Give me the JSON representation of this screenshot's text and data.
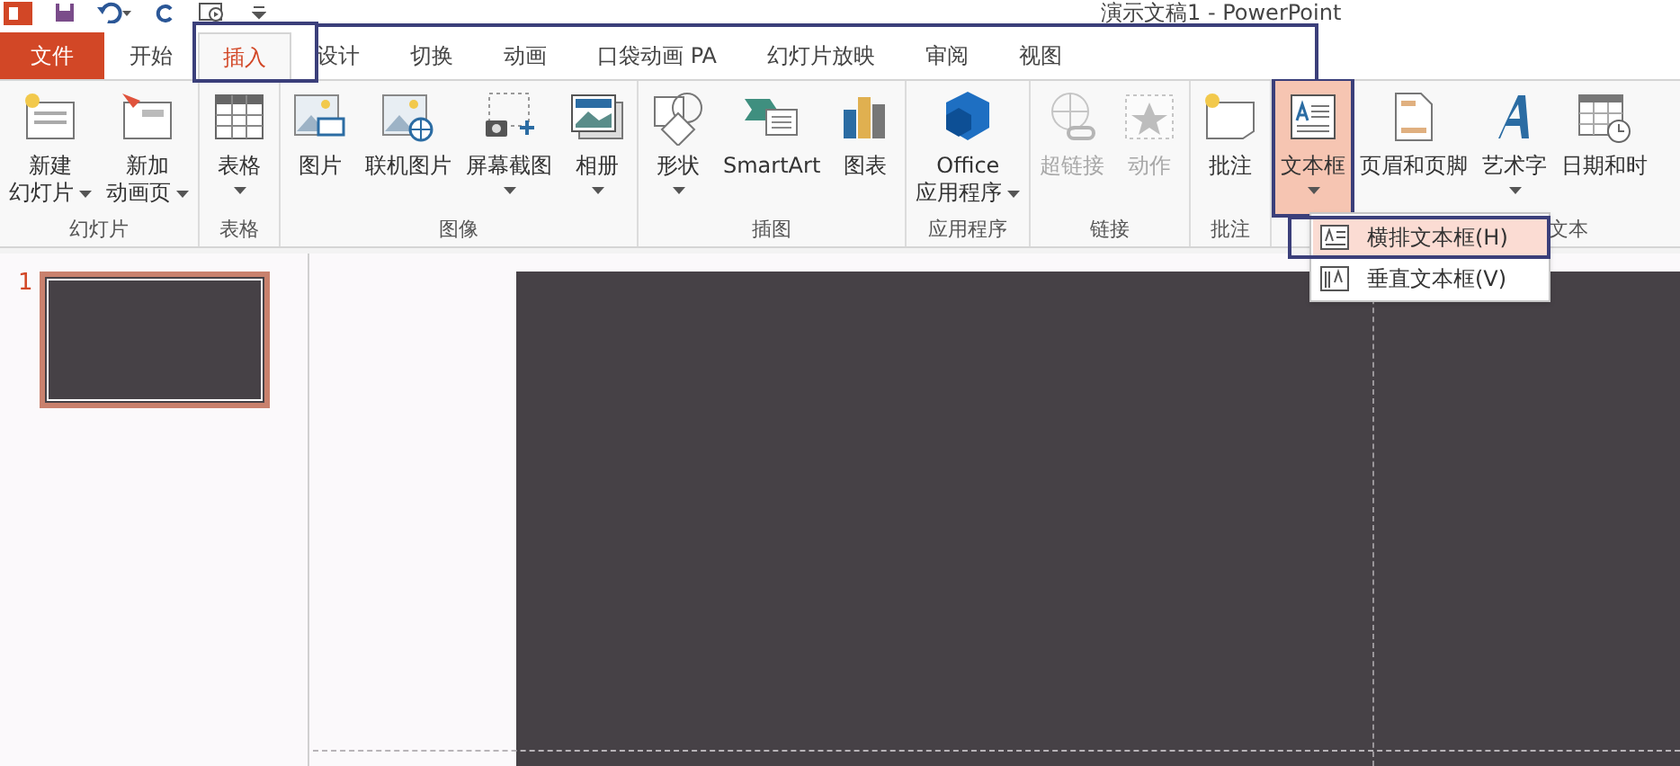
{
  "title_bar": {
    "title": "演示文稿1 - PowerPoint"
  },
  "tabs": [
    {
      "label": "文件",
      "kind": "file",
      "selected": false
    },
    {
      "label": "开始",
      "kind": "tab",
      "selected": false
    },
    {
      "label": "插入",
      "kind": "tab",
      "selected": true
    },
    {
      "label": "设计",
      "kind": "tab",
      "selected": false
    },
    {
      "label": "切换",
      "kind": "tab",
      "selected": false
    },
    {
      "label": "动画",
      "kind": "tab",
      "selected": false
    },
    {
      "label": "口袋动画 PA",
      "kind": "tab",
      "selected": false
    },
    {
      "label": "幻灯片放映",
      "kind": "tab",
      "selected": false
    },
    {
      "label": "审阅",
      "kind": "tab",
      "selected": false
    },
    {
      "label": "视图",
      "kind": "tab",
      "selected": false
    }
  ],
  "ribbon": {
    "groups": [
      {
        "label": "幻灯片",
        "buttons": [
          {
            "kind": "slide",
            "lines": [
              "新建",
              "幻灯片"
            ],
            "dropdown": true,
            "disabled": false,
            "pressed": false
          },
          {
            "kind": "animpage",
            "lines": [
              "新加",
              "动画页"
            ],
            "dropdown": true,
            "disabled": false,
            "pressed": false
          }
        ]
      },
      {
        "label": "表格",
        "buttons": [
          {
            "kind": "table",
            "lines": [
              "表格"
            ],
            "dropdown": true,
            "disabled": false,
            "pressed": false
          }
        ]
      },
      {
        "label": "图像",
        "buttons": [
          {
            "kind": "picture",
            "lines": [
              "图片"
            ],
            "dropdown": false,
            "disabled": false,
            "pressed": false
          },
          {
            "kind": "online",
            "lines": [
              "联机图片"
            ],
            "dropdown": false,
            "disabled": false,
            "pressed": false
          },
          {
            "kind": "screenshot",
            "lines": [
              "屏幕截图"
            ],
            "dropdown": true,
            "disabled": false,
            "pressed": false
          },
          {
            "kind": "album",
            "lines": [
              "相册"
            ],
            "dropdown": true,
            "disabled": false,
            "pressed": false
          }
        ]
      },
      {
        "label": "插图",
        "buttons": [
          {
            "kind": "shapes",
            "lines": [
              "形状"
            ],
            "dropdown": true,
            "disabled": false,
            "pressed": false
          },
          {
            "kind": "smartart",
            "lines": [
              "SmartArt"
            ],
            "dropdown": false,
            "disabled": false,
            "pressed": false
          },
          {
            "kind": "chart",
            "lines": [
              "图表"
            ],
            "dropdown": false,
            "disabled": false,
            "pressed": false
          }
        ]
      },
      {
        "label": "应用程序",
        "buttons": [
          {
            "kind": "store",
            "lines": [
              "Office",
              "应用程序"
            ],
            "dropdown": true,
            "disabled": false,
            "pressed": false
          }
        ]
      },
      {
        "label": "链接",
        "buttons": [
          {
            "kind": "hyperlink",
            "lines": [
              "超链接"
            ],
            "dropdown": false,
            "disabled": true,
            "pressed": false
          },
          {
            "kind": "action",
            "lines": [
              "动作"
            ],
            "dropdown": false,
            "disabled": true,
            "pressed": false
          }
        ]
      },
      {
        "label": "批注",
        "buttons": [
          {
            "kind": "comment",
            "lines": [
              "批注"
            ],
            "dropdown": false,
            "disabled": false,
            "pressed": false
          }
        ]
      },
      {
        "label": "文本",
        "buttons": [
          {
            "kind": "textbox",
            "lines": [
              "文本框"
            ],
            "dropdown": true,
            "disabled": false,
            "pressed": true
          },
          {
            "kind": "header",
            "lines": [
              "页眉和页脚"
            ],
            "dropdown": false,
            "disabled": false,
            "pressed": false
          },
          {
            "kind": "wordart",
            "lines": [
              "艺术字"
            ],
            "dropdown": true,
            "disabled": false,
            "pressed": false
          },
          {
            "kind": "datetime",
            "lines": [
              "日期和时"
            ],
            "dropdown": false,
            "disabled": false,
            "pressed": false
          }
        ]
      }
    ]
  },
  "menu": {
    "items": [
      {
        "label": "横排文本框(H)",
        "kind": "horizontal",
        "selected": true
      },
      {
        "label": "垂直文本框(V)",
        "kind": "vertical",
        "selected": false
      }
    ]
  },
  "slides_pane": {
    "slides": [
      {
        "number": "1",
        "selected": true
      }
    ]
  }
}
